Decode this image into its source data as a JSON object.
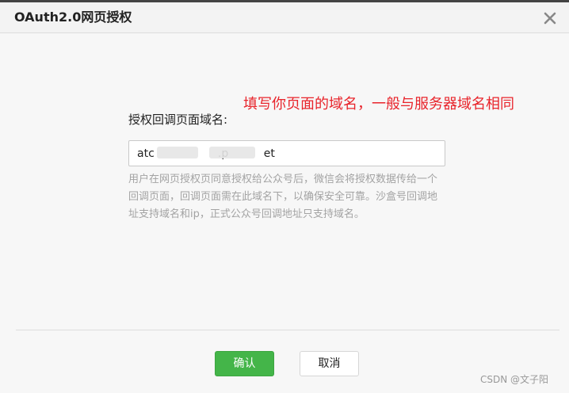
{
  "dialog": {
    "title": "OAuth2.0网页授权",
    "close_icon": "close-icon"
  },
  "annotation": {
    "text": "填写你页面的域名，一般与服务器域名相同",
    "color": "#e8242b"
  },
  "form": {
    "label": "授权回调页面域名:",
    "domain_value": "atc                  .p          et",
    "help_text": "用户在网页授权页同意授权给公众号后，微信会将授权数据传给一个回调页面，回调页面需在此域名下，以确保安全可靠。沙盒号回调地址支持域名和ip，正式公众号回调地址只支持域名。"
  },
  "footer": {
    "confirm_label": "确认",
    "cancel_label": "取消",
    "confirm_color": "#44b549"
  },
  "watermark": {
    "text": "CSDN @文子阳"
  }
}
